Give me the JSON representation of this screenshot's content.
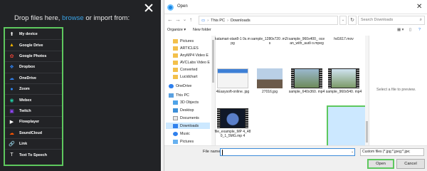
{
  "upload": {
    "heading_prefix": "Drop files here, ",
    "heading_link": "browse",
    "heading_suffix": " or import from:",
    "sources": [
      {
        "label": "My device",
        "icon": "upload-icon",
        "glyph": "⬆",
        "color": "#ffffff"
      },
      {
        "label": "Google Drive",
        "icon": "google-drive-icon",
        "glyph": "▲",
        "color": "#f4b400"
      },
      {
        "label": "Google Photos",
        "icon": "google-photos-icon",
        "glyph": "✿",
        "color": "#ea4335"
      },
      {
        "label": "Dropbox",
        "icon": "dropbox-icon",
        "glyph": "❖",
        "color": "#2f80ed"
      },
      {
        "label": "OneDrive",
        "icon": "onedrive-icon",
        "glyph": "☁",
        "color": "#2f80ed"
      },
      {
        "label": "Zoom",
        "icon": "zoom-icon",
        "glyph": "●",
        "color": "#2d8cff"
      },
      {
        "label": "Webex",
        "icon": "webex-icon",
        "glyph": "◉",
        "color": "#23c7a0"
      },
      {
        "label": "Twitch",
        "icon": "twitch-icon",
        "glyph": "▣",
        "color": "#9146ff"
      },
      {
        "label": "Flowplayer",
        "icon": "flowplayer-icon",
        "glyph": "▶",
        "color": "#ffffff"
      },
      {
        "label": "SoundCloud",
        "icon": "soundcloud-icon",
        "glyph": "☁",
        "color": "#ff5500"
      },
      {
        "label": "Link",
        "icon": "link-icon",
        "glyph": "🔗",
        "color": "#ffffff"
      },
      {
        "label": "Text To Speech",
        "icon": "text-to-speech-icon",
        "glyph": "T",
        "color": "#ffffff"
      }
    ]
  },
  "dialog": {
    "title": "Open",
    "address": {
      "pc": "This PC",
      "folder": "Downloads"
    },
    "search_placeholder": "Search Downloads",
    "toolbar": {
      "organize": "Organize ▾",
      "new_folder": "New folder"
    },
    "nav": [
      {
        "label": "Pictures",
        "type": "folder"
      },
      {
        "label": "ARTICLES",
        "type": "folder"
      },
      {
        "label": "AnyMP4 Video E",
        "type": "folder"
      },
      {
        "label": "AVCLabs Video E",
        "type": "folder"
      },
      {
        "label": "Converted",
        "type": "folder"
      },
      {
        "label": "Lucidchart",
        "type": "folder"
      },
      {
        "label": "OneDrive",
        "type": "cloud"
      },
      {
        "label": "This PC",
        "type": "pc"
      },
      {
        "label": "3D Objects",
        "type": "obj"
      },
      {
        "label": "Desktop",
        "type": "desk"
      },
      {
        "label": "Documents",
        "type": "doc"
      },
      {
        "label": "Downloads",
        "type": "dl",
        "selected": true
      },
      {
        "label": "Music",
        "type": "music"
      },
      {
        "label": "Pictures",
        "type": "pic"
      }
    ],
    "files": [
      {
        "name": "katamari-stan8-1 0s.mpg"
      },
      {
        "name": "sample_1280x720 .m2ts"
      },
      {
        "name": "sample_960x400_ ocean_with_audi o.mpeg"
      },
      {
        "name": "hd1617.mov"
      },
      {
        "name": "4Easysoft-online. jpg"
      },
      {
        "name": "27016.jpg"
      },
      {
        "name": "sample_640x360. mp4"
      },
      {
        "name": "sample_960x540. mp4"
      },
      {
        "name": "file_example_MP 4_480_1_5MG.mp 4"
      }
    ],
    "preview_text": "Select a file to preview.",
    "file_name_label": "File name:",
    "file_name_value": "",
    "filter": "Custom files (*.jpg;*.jpeg;*.jpe;",
    "open_label": "Open",
    "cancel_label": "Cancel"
  }
}
